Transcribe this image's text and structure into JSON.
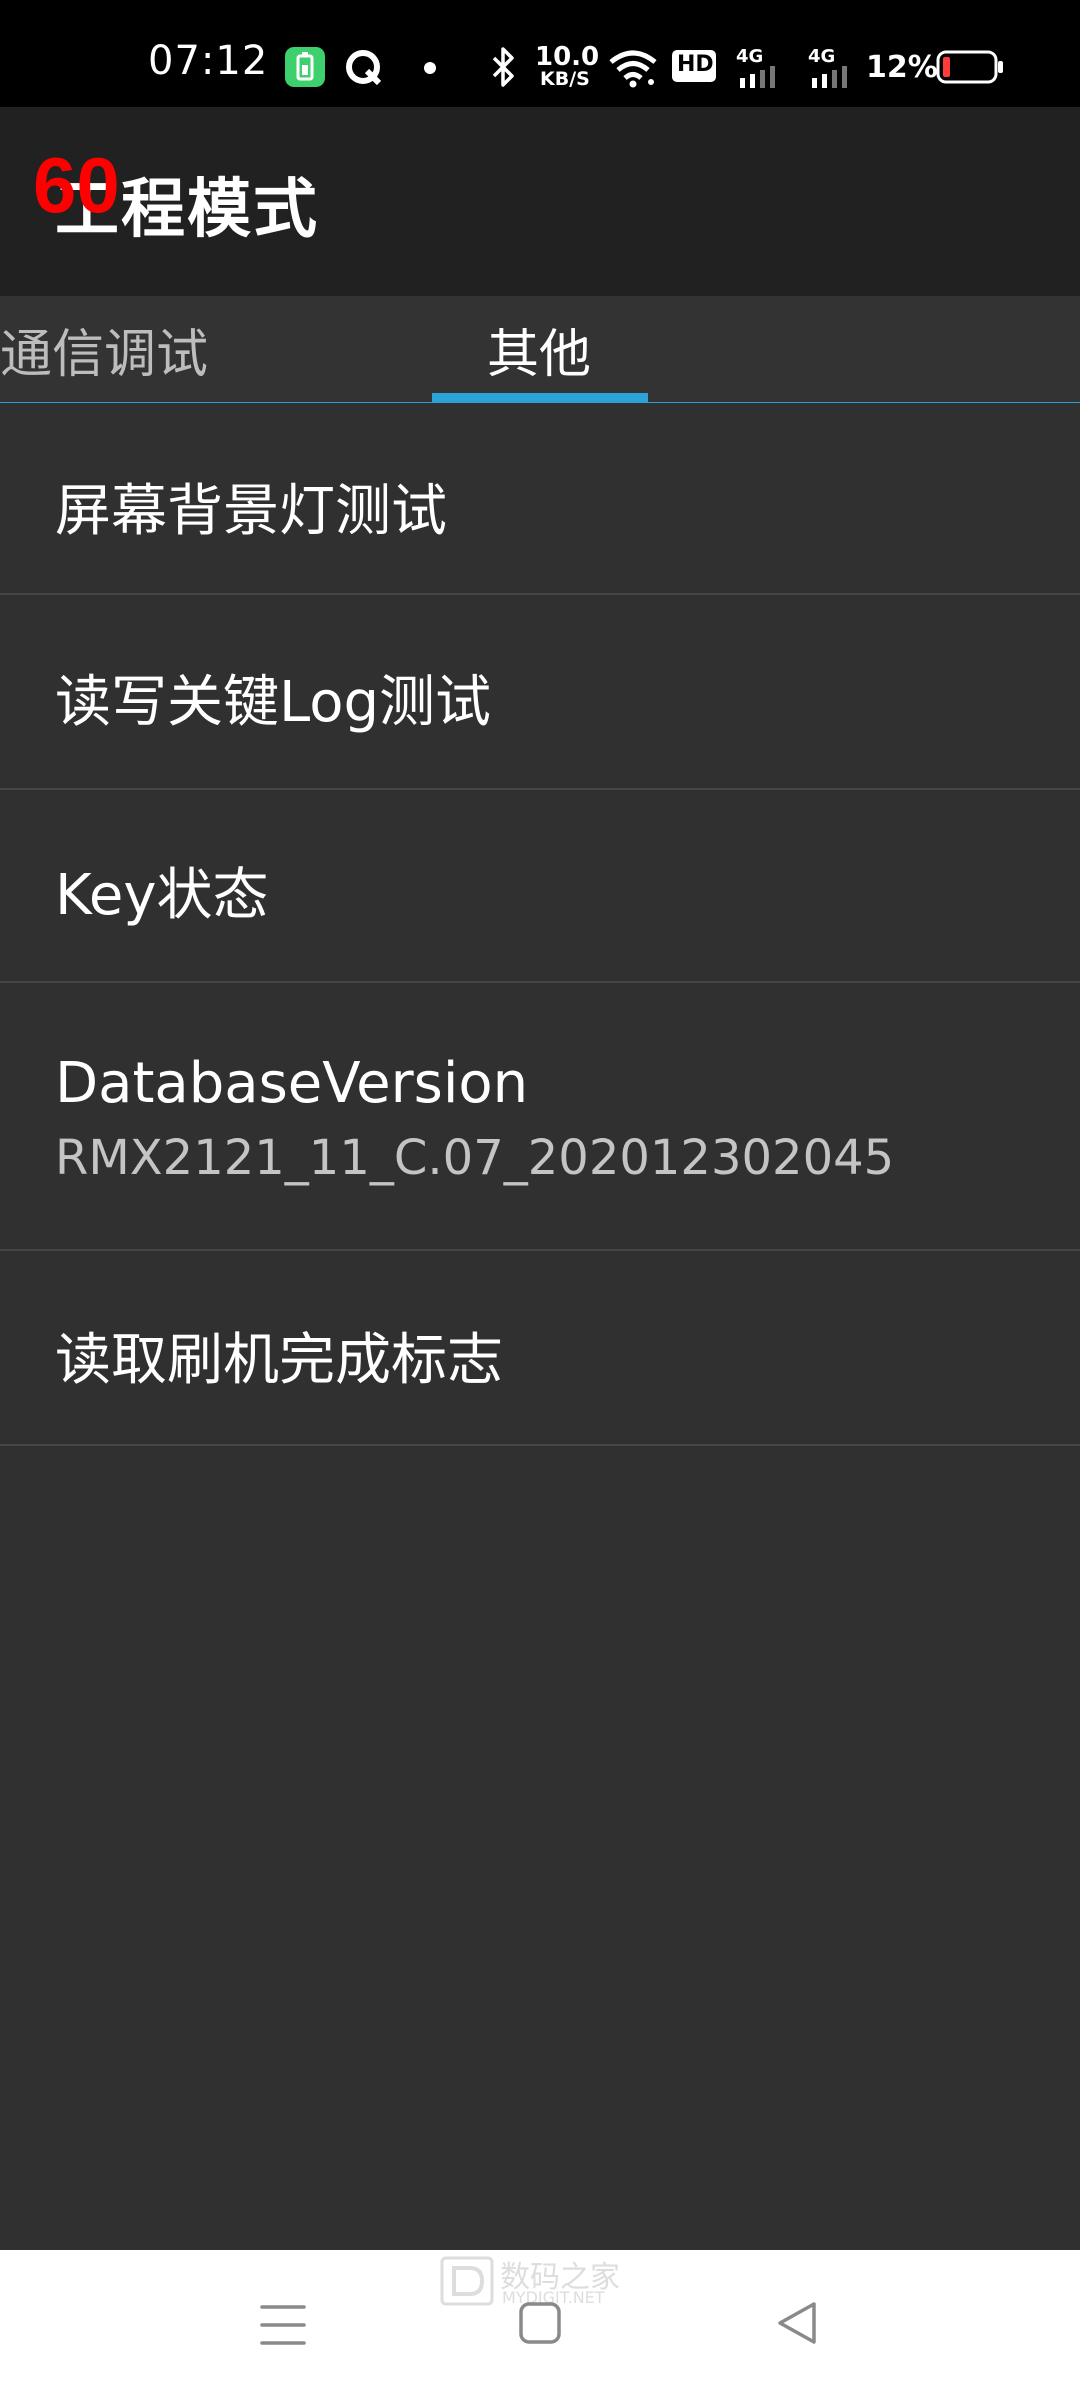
{
  "status_bar": {
    "time": "07:12",
    "net_speed_value": "10.0",
    "net_speed_unit": "KB/S",
    "hd_label": "HD",
    "signal1_label": "4G",
    "signal2_label": "4G",
    "battery_text": "12%",
    "icons": [
      "battery-saver-icon",
      "app-notification-icon",
      "dot-icon",
      "bluetooth-icon",
      "wifi-icon",
      "hd-icon",
      "signal-icon",
      "battery-icon"
    ]
  },
  "app_bar": {
    "title": "工程模式",
    "fps_overlay": "60"
  },
  "tabs": [
    {
      "label": "通信调试",
      "active": false
    },
    {
      "label": "其他",
      "active": true
    }
  ],
  "items": [
    {
      "title": "屏幕背景灯测试"
    },
    {
      "title": "读写关键Log测试"
    },
    {
      "title": "Key状态"
    },
    {
      "title": "DatabaseVersion",
      "subtitle": "RMX2121_11_C.07_202012302045"
    },
    {
      "title": "读取刷机完成标志"
    }
  ],
  "watermark": {
    "text": "数码之家",
    "sub": "MYDIGIT.NET"
  },
  "colors": {
    "accent": "#2ba3d6",
    "background": "#303030",
    "app_bar": "#212121",
    "fps_overlay": "#ff0000"
  }
}
